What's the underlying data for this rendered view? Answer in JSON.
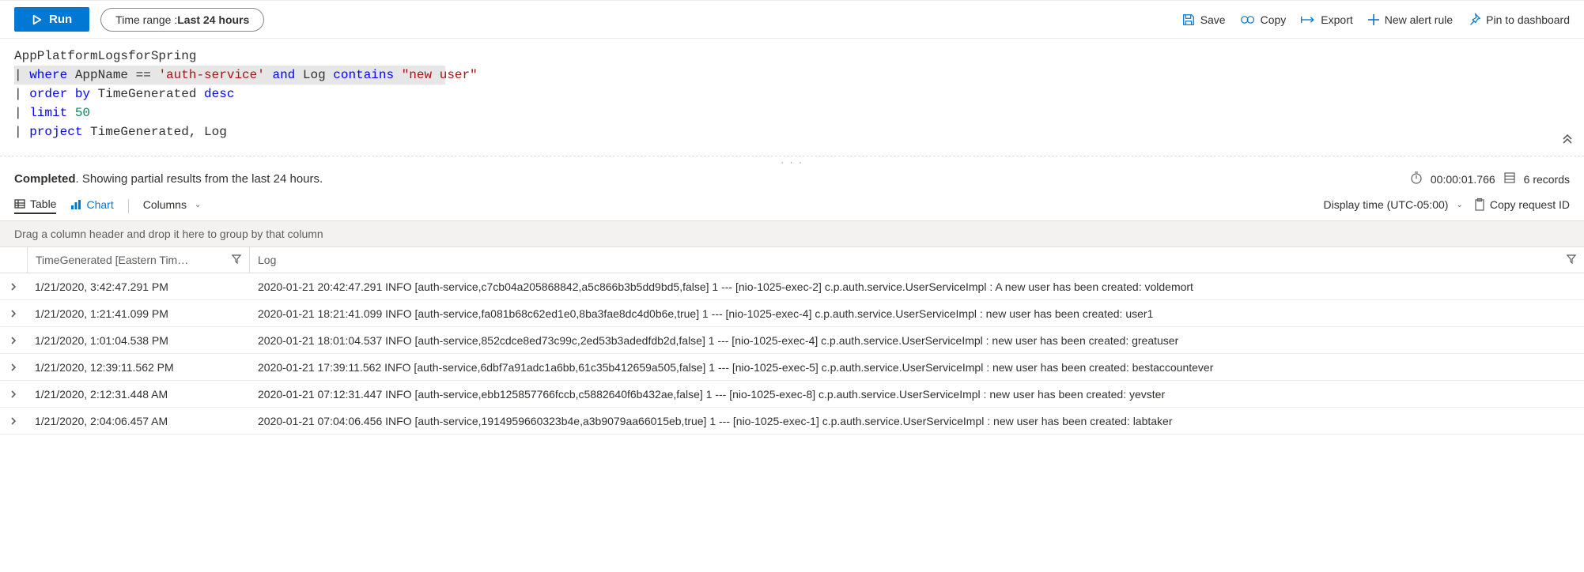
{
  "toolbar": {
    "run_label": "Run",
    "time_range_prefix": "Time range : ",
    "time_range_value": "Last 24 hours",
    "actions": {
      "save": "Save",
      "copy": "Copy",
      "export": "Export",
      "new_alert": "New alert rule",
      "pin": "Pin to dashboard"
    }
  },
  "query": {
    "line1": "AppPlatformLogsforSpring",
    "line2_where": "where",
    "line2_ident1": " AppName == ",
    "line2_str1": "'auth-service'",
    "line2_and": " and",
    "line2_ident2": " Log ",
    "line2_contains": "contains ",
    "line2_str2": "\"new user\"",
    "line3_order": "order by",
    "line3_rest": " TimeGenerated ",
    "line3_desc": "desc",
    "line4_limit": "limit ",
    "line4_num": "50",
    "line5_project": "project",
    "line5_rest": " TimeGenerated, Log"
  },
  "status": {
    "completed": "Completed",
    "message": ". Showing partial results from the last 24 hours.",
    "elapsed": "00:00:01.766",
    "records": "6 records"
  },
  "results_tabs": {
    "table": "Table",
    "chart": "Chart",
    "columns": "Columns",
    "display_time": "Display time (UTC-05:00)",
    "copy_request": "Copy request ID"
  },
  "group_hint": "Drag a column header and drop it here to group by that column",
  "columns": {
    "time": "TimeGenerated [Eastern Tim…",
    "log": "Log"
  },
  "rows": [
    {
      "time": "1/21/2020, 3:42:47.291 PM",
      "log": "2020-01-21 20:42:47.291 INFO [auth-service,c7cb04a205868842,a5c866b3b5dd9bd5,false] 1 --- [nio-1025-exec-2] c.p.auth.service.UserServiceImpl : A new user has been created: voldemort"
    },
    {
      "time": "1/21/2020, 1:21:41.099 PM",
      "log": "2020-01-21 18:21:41.099 INFO [auth-service,fa081b68c62ed1e0,8ba3fae8dc4d0b6e,true] 1 --- [nio-1025-exec-4] c.p.auth.service.UserServiceImpl : new user has been created: user1"
    },
    {
      "time": "1/21/2020, 1:01:04.538 PM",
      "log": "2020-01-21 18:01:04.537 INFO [auth-service,852cdce8ed73c99c,2ed53b3adedfdb2d,false] 1 --- [nio-1025-exec-4] c.p.auth.service.UserServiceImpl : new user has been created: greatuser"
    },
    {
      "time": "1/21/2020, 12:39:11.562 PM",
      "log": "2020-01-21 17:39:11.562 INFO [auth-service,6dbf7a91adc1a6bb,61c35b412659a505,false] 1 --- [nio-1025-exec-5] c.p.auth.service.UserServiceImpl : new user has been created: bestaccountever"
    },
    {
      "time": "1/21/2020, 2:12:31.448 AM",
      "log": "2020-01-21 07:12:31.447 INFO [auth-service,ebb125857766fccb,c5882640f6b432ae,false] 1 --- [nio-1025-exec-8] c.p.auth.service.UserServiceImpl : new user has been created: yevster"
    },
    {
      "time": "1/21/2020, 2:04:06.457 AM",
      "log": "2020-01-21 07:04:06.456 INFO [auth-service,1914959660323b4e,a3b9079aa66015eb,true] 1 --- [nio-1025-exec-1] c.p.auth.service.UserServiceImpl : new user has been created: labtaker"
    }
  ]
}
